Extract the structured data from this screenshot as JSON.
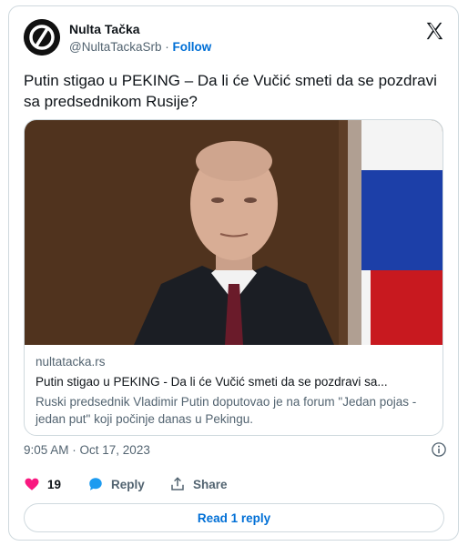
{
  "author": {
    "name": "Nulta Tačka",
    "handle": "@NultaTackaSrb",
    "separator": " · ",
    "follow_label": "Follow"
  },
  "tweet": {
    "text": "Putin stigao u PEKING – Da li će Vučić smeti da se pozdravi sa predsednikom Rusije?"
  },
  "link_card": {
    "domain": "nultatacka.rs",
    "title": "Putin stigao u PEKING - Da li će Vučić smeti da se pozdravi sa...",
    "description": "Ruski predsednik Vladimir Putin doputovao je na forum \"Jedan pojas - jedan put\" koji počinje danas u Pekingu."
  },
  "timestamp": "9:05 AM · Oct 17, 2023",
  "actions": {
    "like_count": "19",
    "reply_label": "Reply",
    "share_label": "Share"
  },
  "read_replies_label": "Read 1 reply",
  "icons": [
    "x-logo-icon",
    "info-icon",
    "heart-icon",
    "reply-bubble-icon",
    "share-icon"
  ],
  "colors": {
    "link_blue": "#006fd6",
    "heart_pink": "#f91880",
    "reply_blue": "#1d9bf0",
    "muted_text": "#536471",
    "border": "#cfd9de"
  }
}
